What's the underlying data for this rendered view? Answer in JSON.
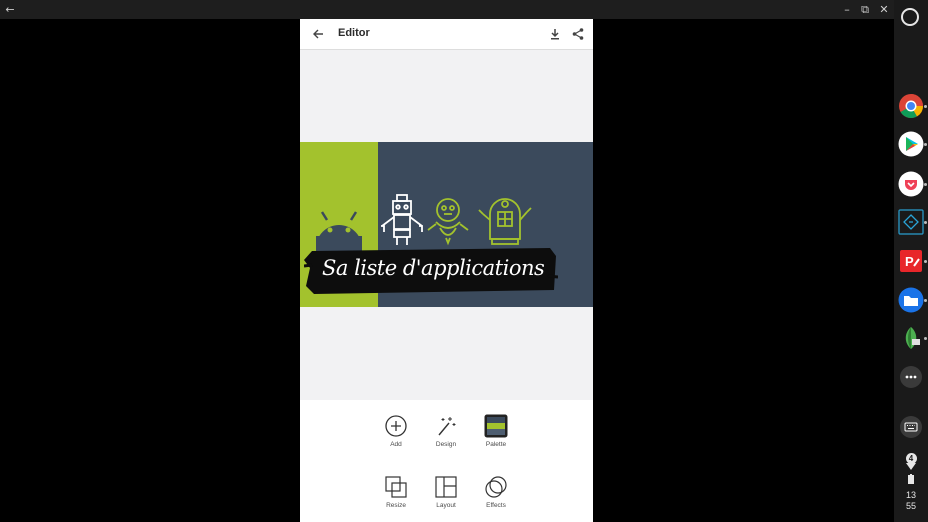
{
  "appbar": {
    "title": "Editor"
  },
  "canvas": {
    "banner_text": "Sa liste d'applications",
    "colors": {
      "green": "#a3c22d",
      "navy": "#3b4a5c",
      "ink": "#0d0d0d"
    }
  },
  "toolbar": {
    "items": [
      {
        "label": "Add",
        "icon": "plus-circle-icon"
      },
      {
        "label": "Design",
        "icon": "magic-wand-icon"
      },
      {
        "label": "Palette",
        "icon": "palette-swatch-icon"
      },
      {
        "label": "Resize",
        "icon": "resize-icon"
      },
      {
        "label": "Layout",
        "icon": "layout-icon"
      },
      {
        "label": "Effects",
        "icon": "effects-circles-icon"
      }
    ]
  },
  "shelf": {
    "apps": [
      "chrome-icon",
      "play-store-icon",
      "pocket-icon",
      "code-app-icon",
      "pdf-editor-icon",
      "files-icon",
      "snapseed-icon",
      "more-apps-icon"
    ],
    "notification_count": "4",
    "time_hours": "13",
    "time_minutes": "55"
  }
}
